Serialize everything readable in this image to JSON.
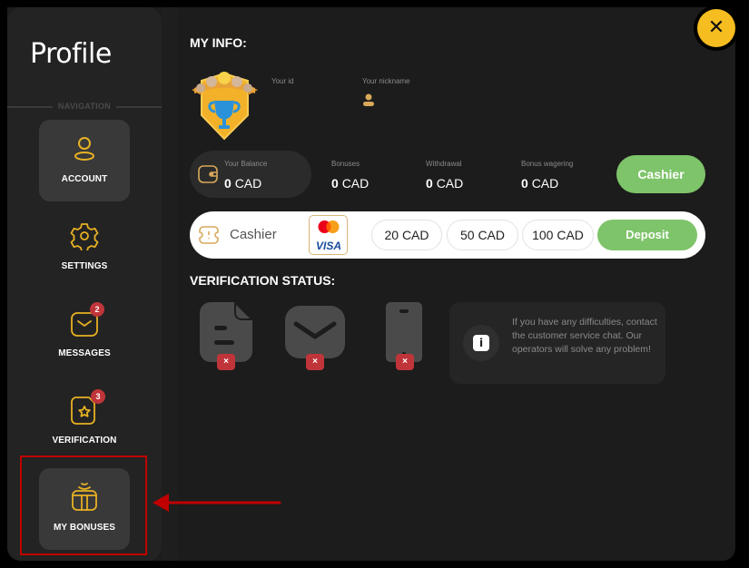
{
  "sidebar": {
    "title": "Profile",
    "nav_label": "NAVIGATION",
    "items": [
      {
        "label": "ACCOUNT",
        "icon": "user-icon",
        "active": true
      },
      {
        "label": "SETTINGS",
        "icon": "gear-icon",
        "active": false
      },
      {
        "label": "MESSAGES",
        "icon": "envelope-icon",
        "badge": "2",
        "active": false
      },
      {
        "label": "VERIFICATION",
        "icon": "star-document-icon",
        "badge": "3",
        "active": false
      },
      {
        "label": "MY BONUSES",
        "icon": "gift-icon",
        "active": true,
        "highlighted": true
      }
    ]
  },
  "my_info": {
    "title": "MY INFO:",
    "id_label": "Your id",
    "nickname_label": "Your nickname"
  },
  "balances": [
    {
      "label": "Your Balance",
      "amount": "0",
      "currency": "CAD"
    },
    {
      "label": "Bonuses",
      "amount": "0",
      "currency": "CAD"
    },
    {
      "label": "Withdrawal",
      "amount": "0",
      "currency": "CAD"
    },
    {
      "label": "Bonus wagering",
      "amount": "0",
      "currency": "CAD"
    }
  ],
  "cashier_button": "Cashier",
  "deposit_bar": {
    "title": "Cashier",
    "card_brand_text": "VISA",
    "amounts": [
      "20 CAD",
      "50 CAD",
      "100 CAD"
    ],
    "deposit_button": "Deposit"
  },
  "verification": {
    "title": "VERIFICATION STATUS:",
    "items": [
      {
        "icon": "document-icon",
        "status": "×"
      },
      {
        "icon": "email-icon",
        "status": "×"
      },
      {
        "icon": "phone-icon",
        "status": "×"
      }
    ],
    "help_text": "If you have any difficulties, contact the customer service chat. Our operators will solve any problem!",
    "info_glyph": "i"
  },
  "close_glyph": "✕",
  "colors": {
    "accent_yellow": "#f5bd1f",
    "icon_gold": "#e7b123",
    "green": "#7ec46a",
    "badge_red": "#c0353a",
    "highlight_red": "#c00000"
  }
}
